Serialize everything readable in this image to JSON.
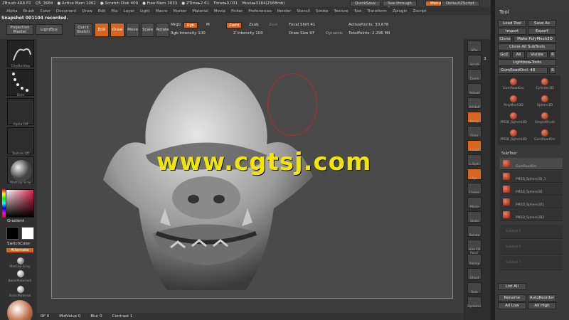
{
  "app": {
    "title": "ZBrush 4R6 P2",
    "file": "Q5_3684",
    "stats": [
      "● Active Mem 1062",
      "● Scratch Disk 409",
      "● Free Mem 3033",
      "● ZTime▸2.61",
      "Timer▸0.031",
      "Movie▸3184(2568mb)"
    ],
    "quicksave": "QuickSave",
    "seethrough": "See-through",
    "seethrough_value": "0",
    "menus_btn": "Menus",
    "script": "DefaultZScript"
  },
  "menubar": [
    "Alpha",
    "Brush",
    "Color",
    "Document",
    "Draw",
    "Edit",
    "File",
    "Layer",
    "Light",
    "Macro",
    "Marker",
    "Material",
    "Movie",
    "Picker",
    "Preferences",
    "Render",
    "Stencil",
    "Stroke",
    "Texture",
    "Tool",
    "Transform",
    "Zplugin",
    "Zscript"
  ],
  "toolbar": {
    "notice": "Snapshot 001104 recorded.",
    "projection_master": "Projection Master",
    "lightbox": "LightBox",
    "quick_sketch": "Quick Sketch",
    "edit": "Edit",
    "draw": "Draw",
    "move": "Move",
    "scale": "Scale",
    "rotate": "Rotate",
    "mrgb": "Mrgb",
    "rgb": "Rgb",
    "m": "M",
    "zadd": "Zadd",
    "zsub": "Zsub",
    "zcut": "Zcut",
    "rgb_intensity": "Rgb Intensity 100",
    "z_intensity": "Z Intensity 100",
    "focal_shift": "Focal Shift 41",
    "draw_size": "Draw Size 97",
    "dynamic": "Dynamic",
    "active_points": "ActivePoints: 30,678",
    "total_points": "TotalPoints: 2.296 Mil"
  },
  "left": {
    "brush": "ClayBuildup",
    "stroke": "Dots",
    "alpha": "Alpha Off",
    "texture": "Texture Off",
    "material": "MatCap Gray",
    "gradient": "Gradient",
    "switchcolor": "SwitchColor",
    "alternate": "Alternate",
    "mat1": "MatCap Gray",
    "mat2": "BasicMaterial2",
    "mat3": "BasicMaterial"
  },
  "right_strip": [
    "SPix",
    "Scroll",
    "Zoom",
    "Actual",
    "AAHalf",
    "Persp",
    "Floor",
    "Local",
    "L.Sym",
    "Xyz",
    "Frame",
    "Move",
    "Scale",
    "Rotate",
    "Line Fill PolyF",
    "Transp",
    "Ghost",
    "Solo",
    "Dynamic"
  ],
  "spix_value": "3",
  "tool": {
    "header": "Tool",
    "load_tool": "Load Tool",
    "save_as": "Save As",
    "import": "Import",
    "export": "Export",
    "clone": "Clone",
    "make_polymesh": "Make PolyMesh3D",
    "clone_subtools": "Clone All SubTools",
    "goz": "GoZ",
    "all": "All",
    "visible": "Visible",
    "r": "R",
    "lightbox_tools": "Lightbox▸Tools",
    "current_tool": "GumRoadOrcl. 48",
    "tool_items": [
      "GumRoadOrc",
      "Cylinder3D",
      "PolyMesh3D",
      "Sphere3D",
      "PM3D_Sphere3D",
      "SimpleBrush",
      "PM3D_Sphere3D",
      "GumRoadOrc"
    ]
  },
  "subtool": {
    "header": "SubTool",
    "items": [
      "GumRoadOrc",
      "PM3D_Sphere3D_1",
      "PM3D_Sphere3D",
      "PM3D_Sphere3D1",
      "PM3D_Sphere3D2"
    ],
    "empty": [
      "Subtool 5",
      "Subtool 6",
      "Subtool 7"
    ],
    "list_all": "List All",
    "rename": "Rename",
    "autoreorder": "AutoReorder",
    "all_low": "All Low",
    "all_high": "All High"
  },
  "bottom": {
    "rf": "RF 0",
    "midvalue": "MidValue 0",
    "blur": "Blur 0",
    "contrast": "Contrast 1"
  },
  "watermark": "www.cgtsj.com",
  "colors": {
    "accent": "#d8661f",
    "watermark": "#f2e600"
  }
}
